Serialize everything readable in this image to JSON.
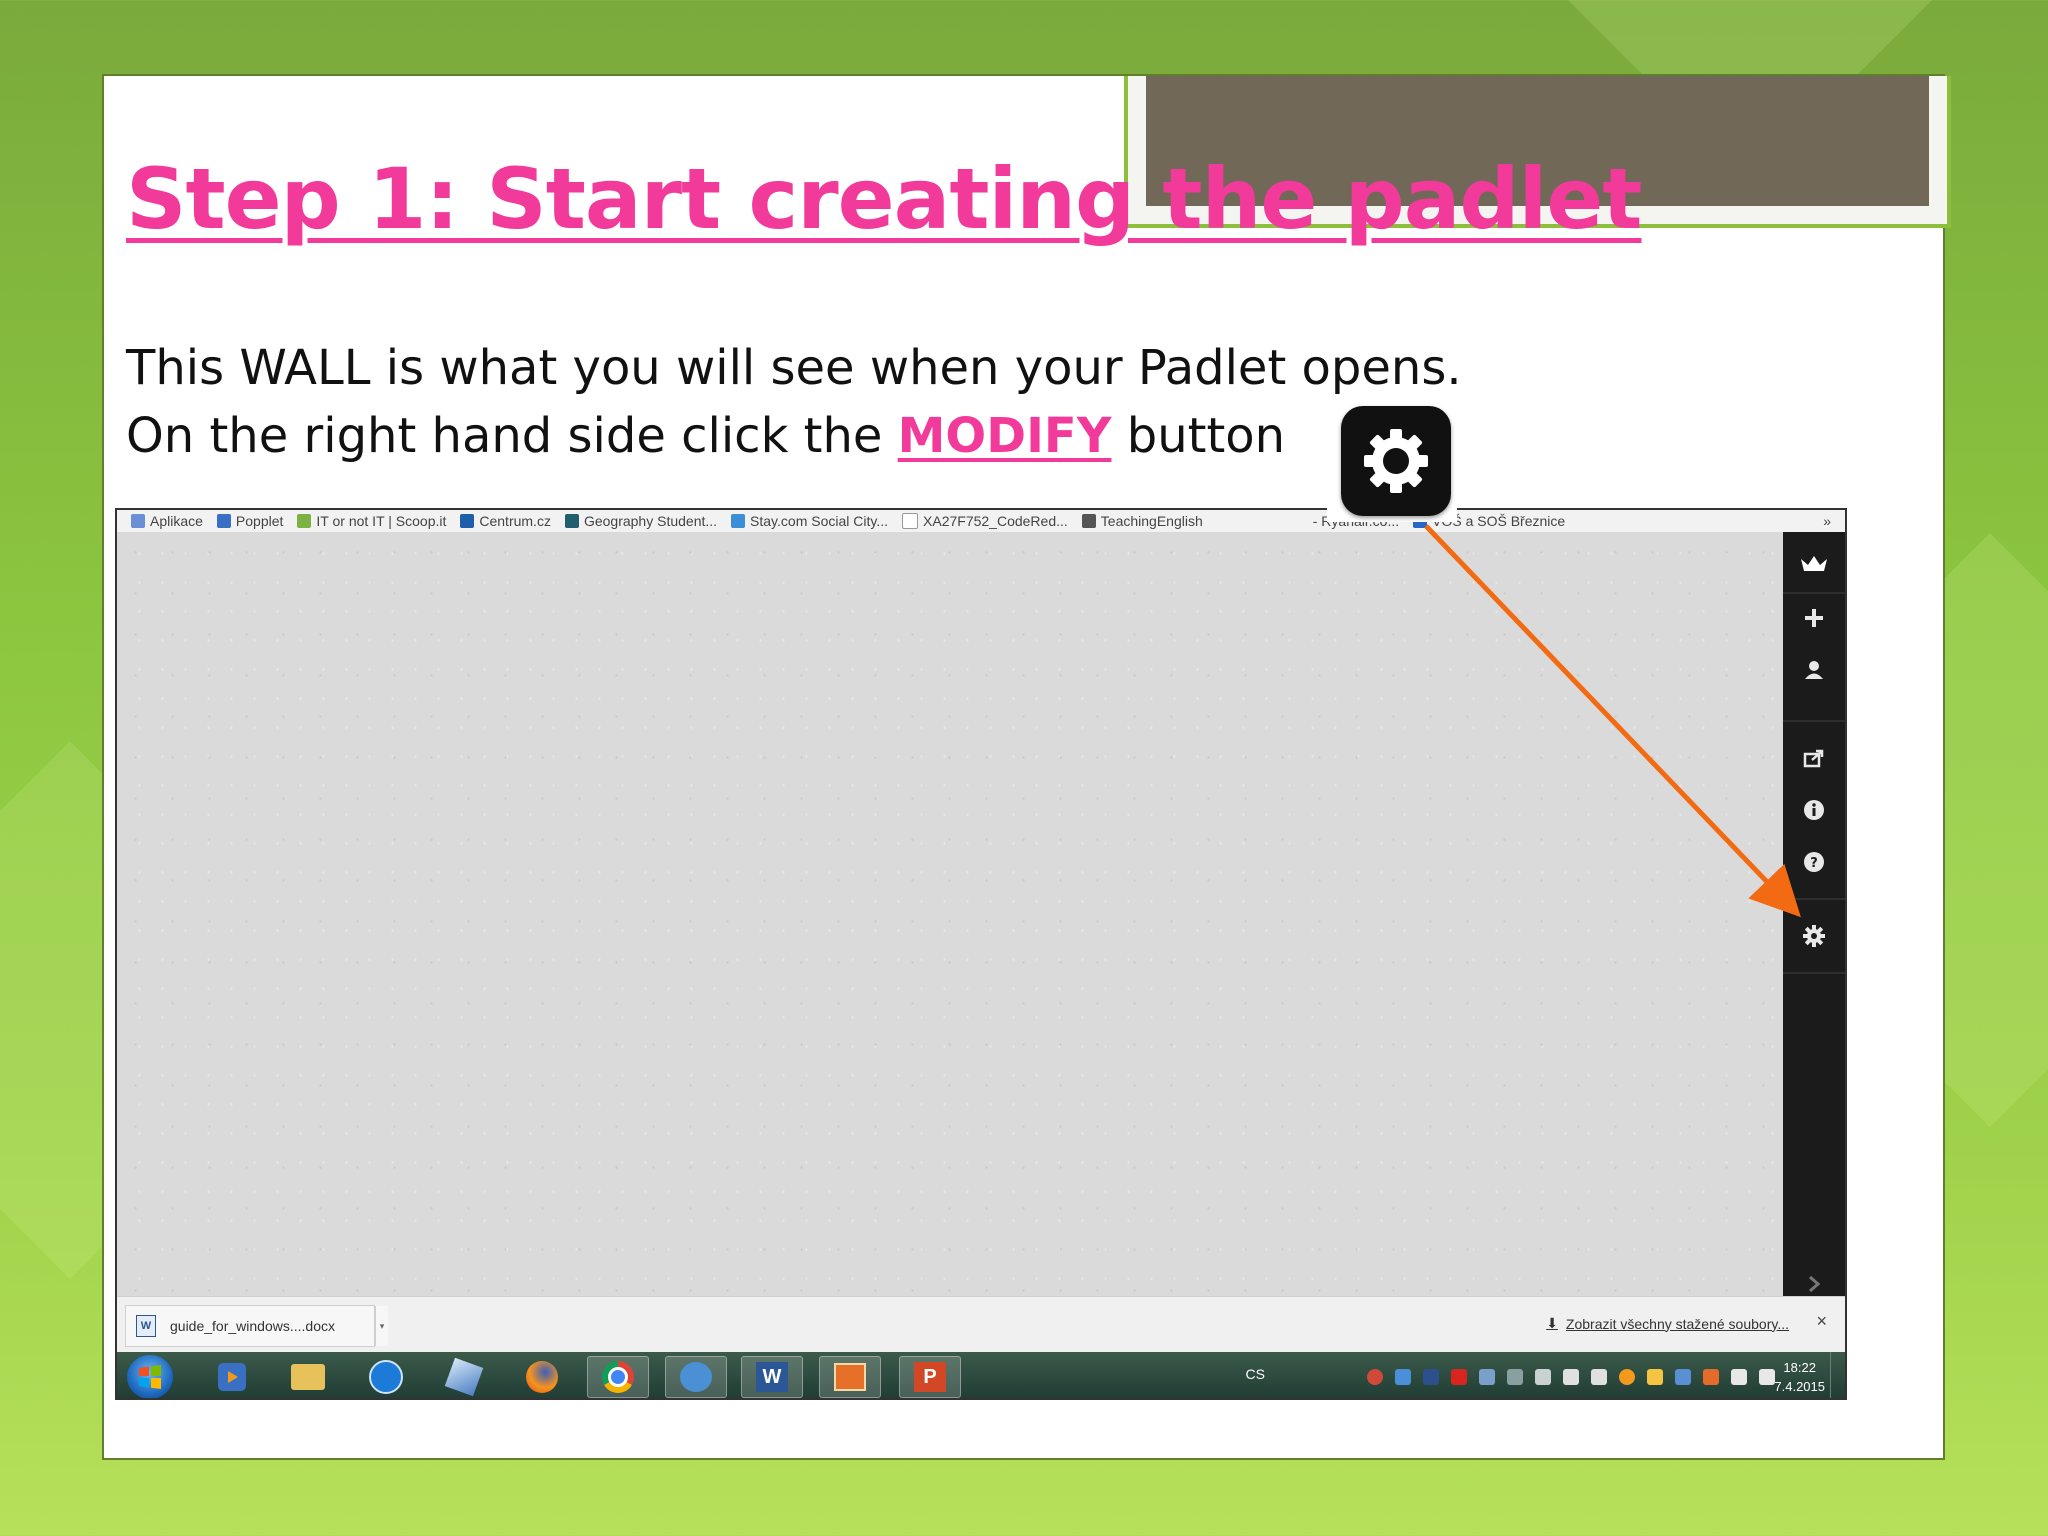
{
  "slide": {
    "heading": "Step 1: Start creating the padlet",
    "line1": "This WALL is what you will see when your Padlet opens.",
    "line2_prefix": "On the right hand side click the ",
    "line2_highlight": "MODIFY",
    "line2_suffix": " button"
  },
  "colors": {
    "heading": "#f23a9a",
    "arrow": "#f26a12",
    "title_tab": "#716858",
    "slide_border": "#8cbf3c"
  },
  "browser": {
    "bookmarks": [
      {
        "label": "Aplikace",
        "icon": "apps-grid-icon"
      },
      {
        "label": "Popplet",
        "icon": "popplet-icon"
      },
      {
        "label": "IT or not IT | Scoop.it",
        "icon": "scoopit-icon"
      },
      {
        "label": "Centrum.cz",
        "icon": "centrum-icon"
      },
      {
        "label": "Geography Student...",
        "icon": "geography-icon"
      },
      {
        "label": "Stay.com Social City...",
        "icon": "stay-icon"
      },
      {
        "label": "XA27F752_CodeRed...",
        "icon": "document-icon"
      },
      {
        "label": "TeachingEnglish",
        "icon": "teachingenglish-icon"
      },
      {
        "label": "- Ryanair.co...",
        "icon": "ryanair-icon"
      },
      {
        "label": "VOŠ a SOŠ Březnice",
        "icon": "school-icon"
      }
    ],
    "bookmarks_more": "»",
    "sidebar_icons": [
      "crown-icon",
      "plus-icon",
      "user-icon",
      "share-icon",
      "info-icon",
      "help-icon",
      "gear-icon",
      "chevron-right-icon"
    ],
    "download": {
      "file_name": "guide_for_windows....docx",
      "show_all": "Zobrazit všechny stažené soubory...",
      "close": "×"
    }
  },
  "taskbar": {
    "apps": [
      "media-player-icon",
      "file-explorer-icon",
      "teamviewer-icon",
      "paint-icon",
      "firefox-icon",
      "chrome-icon",
      "palette-icon",
      "word-icon",
      "presentation-tool-icon",
      "powerpoint-icon"
    ],
    "language": "CS",
    "time": "18:22",
    "date": "7.4.2015"
  }
}
